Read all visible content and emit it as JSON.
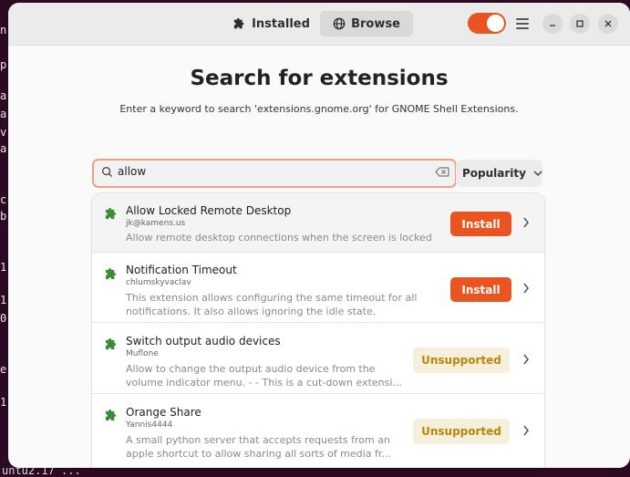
{
  "terminal": {
    "left_chars": [
      "n",
      "p",
      "a",
      "a",
      "v",
      "a",
      "c",
      "b",
      "1",
      "1",
      "0",
      "e",
      "1"
    ],
    "bottom_text": "untu2.17 ..."
  },
  "header": {
    "tabs": [
      {
        "label": "Installed",
        "icon": "puzzle-icon"
      },
      {
        "label": "Browse",
        "icon": "globe-icon"
      }
    ],
    "toggle_on": true
  },
  "main": {
    "title": "Search for extensions",
    "subtitle": "Enter a keyword to search 'extensions.gnome.org' for GNOME Shell Extensions."
  },
  "search": {
    "value": "allow",
    "sort_label": "Popularity"
  },
  "results": [
    {
      "name": "Allow Locked Remote Desktop",
      "author": "jk@kamens.us",
      "desc": [
        "Allow remote desktop connections when the screen is locked"
      ],
      "action": "Install"
    },
    {
      "name": "Notification Timeout",
      "author": "chlumskyvaclav",
      "desc": [
        "This extension allows configuring the same timeout for all",
        "notifications. It also allows ignoring the idle state."
      ],
      "action": "Install"
    },
    {
      "name": "Switch output audio devices",
      "author": "Muflone",
      "desc": [
        "Allow to change the output audio device from the",
        "volume indicator menu. - - This is a cut-down extensi..."
      ],
      "action": "Unsupported"
    },
    {
      "name": "Orange Share",
      "author": "Yannis4444",
      "desc": [
        "A small python server that accepts requests from an",
        "apple shortcut to allow sharing all sorts of media fr..."
      ],
      "action": "Unsupported"
    }
  ],
  "colors": {
    "accent": "#e95420",
    "unsupported_bg": "#f5efdc",
    "unsupported_fg": "#b8860b",
    "puzzle": "#3c8c35"
  }
}
